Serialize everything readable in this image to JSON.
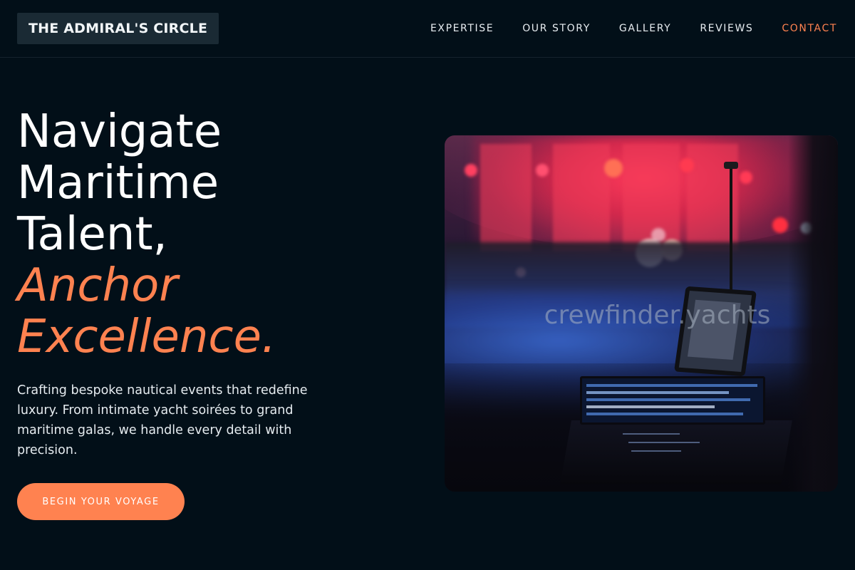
{
  "brand": {
    "name": "THE ADMIRAL'S CIRCLE"
  },
  "nav": {
    "items": [
      "EXPERTISE",
      "OUR STORY",
      "GALLERY",
      "REVIEWS",
      "CONTACT"
    ],
    "active": "CONTACT"
  },
  "hero": {
    "headline": [
      "Navigate",
      "Maritime",
      "Talent,"
    ],
    "headline_accent": [
      "Anchor",
      "Excellence."
    ],
    "lede": "Crafting bespoke nautical events that redefine luxury. From intimate yacht soirées to grand maritime galas, we handle every detail with precision.",
    "cta_label": "BEGIN YOUR VOYAGE",
    "image": {
      "subject": "concert-stage-with-mixing-console",
      "watermark": "crewfinder.yachts"
    }
  },
  "colors": {
    "background": "#020f18",
    "accent": "#ff8250",
    "logo_bg": "#1a2a34",
    "text": "#ffffff"
  }
}
